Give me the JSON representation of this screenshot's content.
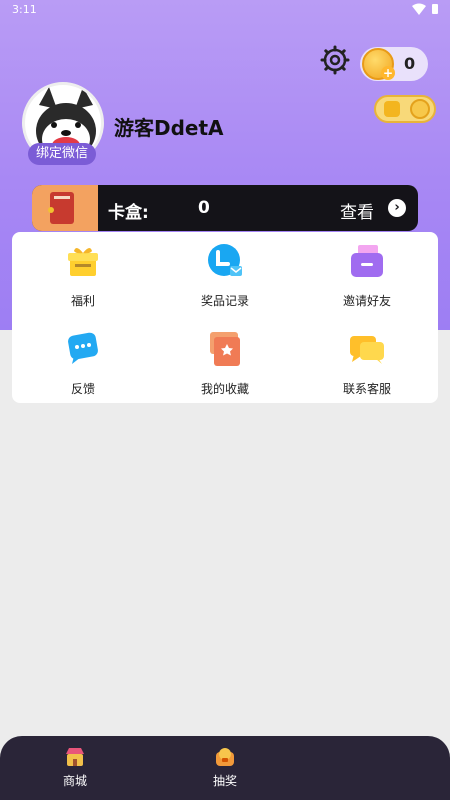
{
  "status_bar": {
    "time": "3:11"
  },
  "header": {
    "coin_count": "0"
  },
  "profile": {
    "bind_label": "绑定微信",
    "username": "游客DdetA"
  },
  "card_box": {
    "label": "卡盒:",
    "value": "0",
    "view_label": "查看"
  },
  "menu": {
    "items": [
      {
        "label": "福利",
        "icon": "gift-icon",
        "color": "#ffcf2e"
      },
      {
        "label": "奖品记录",
        "icon": "prize-record-icon",
        "color": "#19a7f2"
      },
      {
        "label": "邀请好友",
        "icon": "invite-icon",
        "color": "#a06cf0"
      },
      {
        "label": "反馈",
        "icon": "feedback-icon",
        "color": "#23a9f2"
      },
      {
        "label": "我的收藏",
        "icon": "favorites-icon",
        "color": "#f07b55"
      },
      {
        "label": "联系客服",
        "icon": "customer-service-icon",
        "color": "#ffbf2a"
      }
    ]
  },
  "bottom_nav": {
    "items": [
      {
        "label": "商城",
        "icon": "shop-icon"
      },
      {
        "label": "抽奖",
        "icon": "lottery-icon"
      }
    ]
  },
  "colors": {
    "accent": "#a888f4",
    "dark": "#141318",
    "nav_bg": "#2a2538"
  }
}
